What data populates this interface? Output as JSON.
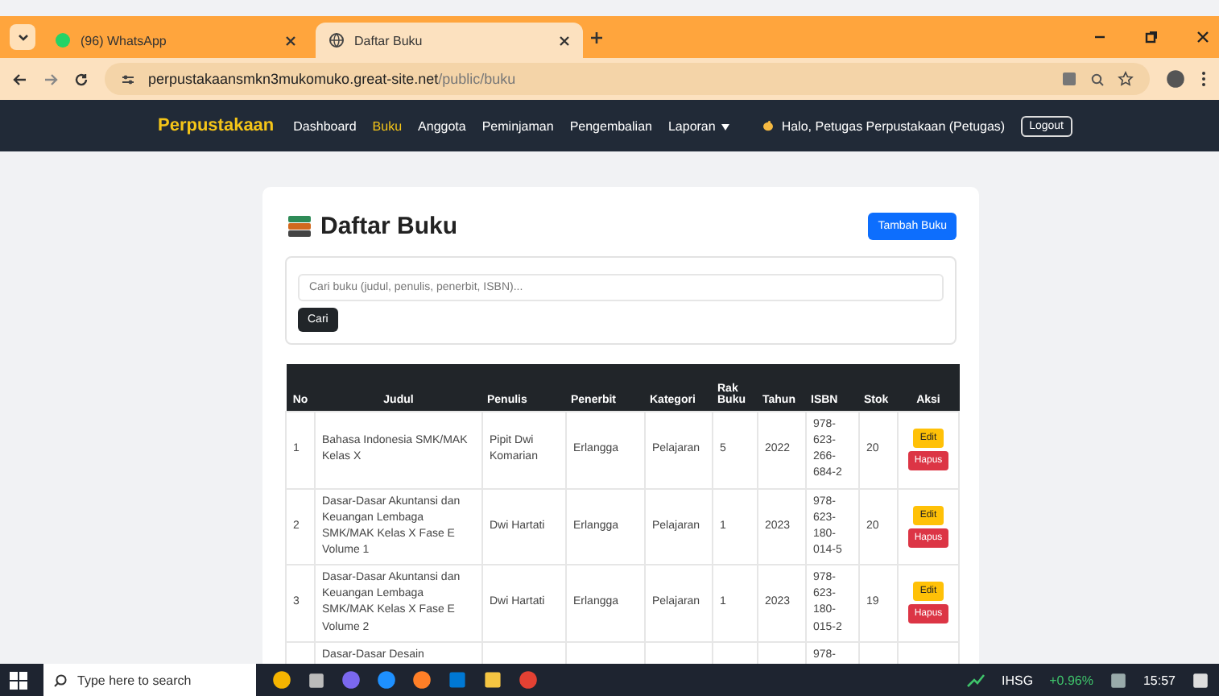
{
  "browser": {
    "tabs": [
      {
        "title": "(96) WhatsApp",
        "selected": false,
        "kind": "whatsapp"
      },
      {
        "title": "Daftar Buku",
        "selected": true,
        "kind": "globe"
      }
    ],
    "url_host": "perpustakaansmkn3mukomuko.great-site.net",
    "url_path": "/public/buku"
  },
  "navbar": {
    "brand": "Perpustakaan",
    "items": [
      {
        "label": "Dashboard",
        "selected": false,
        "dropdown": false
      },
      {
        "label": "Buku",
        "selected": true,
        "dropdown": false
      },
      {
        "label": "Anggota",
        "selected": false,
        "dropdown": false
      },
      {
        "label": "Peminjaman",
        "selected": false,
        "dropdown": false
      },
      {
        "label": "Pengembalian",
        "selected": false,
        "dropdown": false
      },
      {
        "label": "Laporan",
        "selected": false,
        "dropdown": true
      }
    ],
    "greeting": "Halo, Petugas Perpustakaan (Petugas)",
    "logout": "Logout"
  },
  "page": {
    "title": "Daftar Buku",
    "add_button": "Tambah Buku",
    "search": {
      "placeholder": "Cari buku (judul, penulis, penerbit, ISBN)...",
      "button": "Cari"
    }
  },
  "table": {
    "columns": [
      "No",
      "Judul",
      "Penulis",
      "Penerbit",
      "Kategori",
      "Rak Buku",
      "Tahun",
      "ISBN",
      "Stok",
      "Aksi"
    ],
    "rows": [
      {
        "cells": [
          "1",
          "Bahasa Indonesia SMK/MAK Kelas X",
          "Pipit Dwi Komarian",
          "Erlangga",
          "Pelajaran",
          "5",
          "2022",
          "978-623-266-684-2",
          "20"
        ],
        "actions": [
          "Edit",
          "Hapus"
        ]
      },
      {
        "cells": [
          "2",
          "Dasar-Dasar Akuntansi dan Keuangan Lembaga SMK/MAK Kelas X Fase E Volume 1",
          "Dwi Hartati",
          "Erlangga",
          "Pelajaran",
          "1",
          "2023",
          "978-623-180-014-5",
          "20"
        ],
        "actions": [
          "Edit",
          "Hapus"
        ]
      },
      {
        "cells": [
          "3",
          "Dasar-Dasar Akuntansi dan Keuangan Lembaga SMK/MAK Kelas X Fase E Volume 2",
          "Dwi Hartati",
          "Erlangga",
          "Pelajaran",
          "1",
          "2023",
          "978-623-180-015-2",
          "19"
        ],
        "actions": [
          "Edit",
          "Hapus"
        ]
      },
      {
        "cells": [
          "",
          "Dasar-Dasar Desain",
          "",
          "",
          "",
          "",
          "",
          "978-",
          ""
        ],
        "actions": []
      }
    ]
  },
  "taskbar": {
    "search_placeholder": "Type here to search",
    "ticker": "IHSG",
    "change": "+0.96%",
    "time": "15:57"
  }
}
